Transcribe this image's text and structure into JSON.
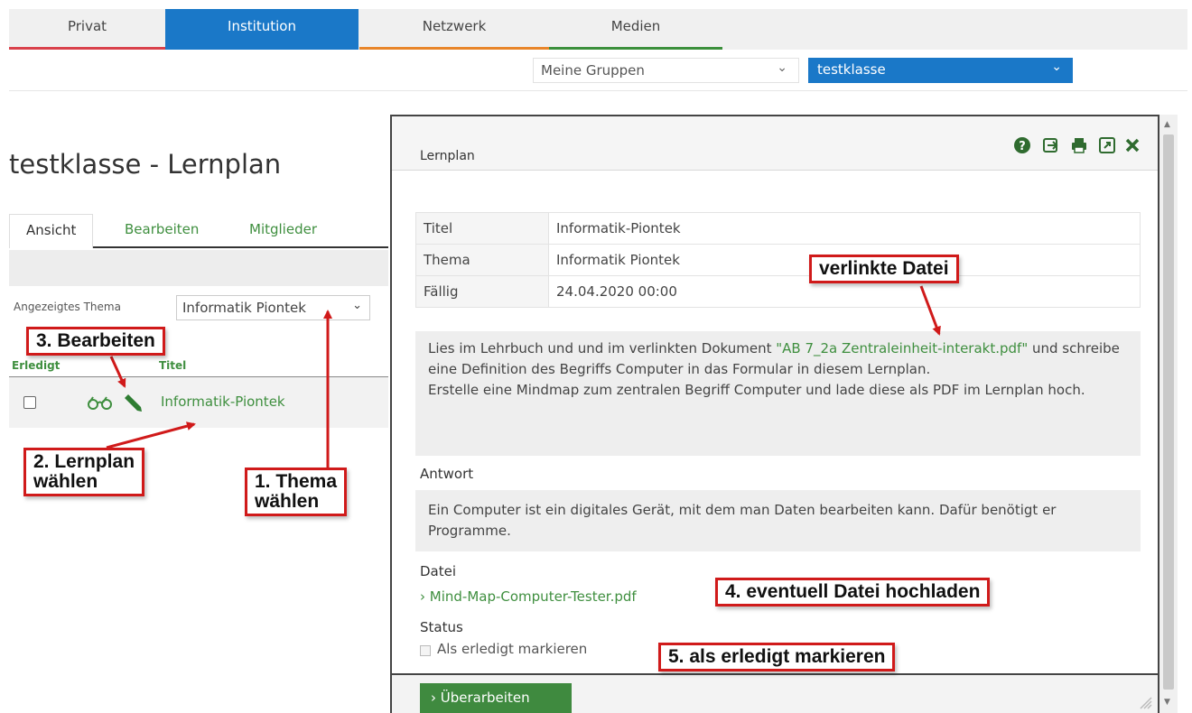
{
  "nav": {
    "tabs": [
      {
        "label": "Privat",
        "accent": "#d9414b"
      },
      {
        "label": "Institution",
        "accent": "#1a78c8"
      },
      {
        "label": "Netzwerk",
        "accent": "#e8852a"
      },
      {
        "label": "Medien",
        "accent": "#3b8f3b"
      }
    ],
    "active_tab": "Institution",
    "groups_select": "Meine Gruppen",
    "class_select": "testklasse"
  },
  "left": {
    "page_title": "testklasse - Lernplan",
    "tabs": {
      "view": "Ansicht",
      "edit": "Bearbeiten",
      "members": "Mitglieder"
    },
    "theme_label": "Angezeigtes Thema",
    "theme_value": "Informatik Piontek",
    "columns": {
      "done": "Erledigt",
      "title": "Titel"
    },
    "row": {
      "title": "Informatik-Piontek",
      "icons": [
        "glasses-icon",
        "pencil-icon"
      ]
    }
  },
  "modal": {
    "title": "Lernplan",
    "header_icons": [
      "help-icon",
      "export-icon",
      "print-icon",
      "open-external-icon",
      "close-icon"
    ],
    "rows": [
      {
        "key": "Titel",
        "value": "Informatik-Piontek"
      },
      {
        "key": "Thema",
        "value": "Informatik Piontek"
      },
      {
        "key": "Fällig",
        "value": "24.04.2020 00:00"
      }
    ],
    "description": {
      "before": "Lies im Lehrbuch und und im verlinkten Dokument ",
      "link": "\"AB 7_2a Zentraleinheit-interakt.pdf\"",
      "after": " und schreibe eine Definition des Begriffs Computer in das Formular in diesem Lernplan.",
      "line2": "Erstelle eine Mindmap zum zentralen Begriff Computer und lade diese als PDF im Lernplan hoch."
    },
    "answer_label": "Antwort",
    "answer": "Ein Computer ist ein digitales Gerät, mit dem man Daten bearbeiten kann. Dafür benötigt er Programme.",
    "file_label": "Datei",
    "file_name": "Mind-Map-Computer-Tester.pdf",
    "status_label": "Status",
    "status_checkbox": "Als erledigt markieren",
    "submit": "Überarbeiten"
  },
  "annotations": {
    "step3": "3. Bearbeiten",
    "step2_line1": "2. Lernplan",
    "step2_line2": "wählen",
    "step1_line1": "1. Thema",
    "step1_line2": "wählen",
    "linked": "verlinkte Datei",
    "step4": "4. eventuell Datei hochladen",
    "step5": "5. als erledigt markieren"
  },
  "colors": {
    "green": "#3f8f3f",
    "blue": "#1a78c8",
    "annotation_red": "#d01a1a"
  }
}
